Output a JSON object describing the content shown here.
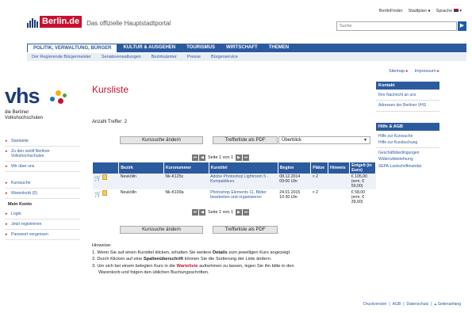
{
  "header": {
    "logo_text": "Berlin.de",
    "subtitle": "Das offizielle Hauptstadtportal",
    "topnav": [
      "BerlinFinder",
      "Stadtplan",
      "Sprache"
    ],
    "search_placeholder": "Suche"
  },
  "mainnav": [
    "POLITIK, VERWALTUNG, BÜRGER",
    "KULTUR & AUSGEHEN",
    "TOURISMUS",
    "WIRTSCHAFT",
    "THEMEN"
  ],
  "subnav": [
    "Der Regierende Bürgermeister",
    "Senatsverwaltungen",
    "Bezirksämter",
    "Presse",
    "Bürgerservice"
  ],
  "vhs": {
    "word": "vhs",
    "sub1": "die Berliner",
    "sub2": "Volkshochschulen"
  },
  "leftnav": {
    "items1": [
      "Startseite",
      "Zu den zwölf Berliner Volkshochschulen",
      "Wir über uns"
    ],
    "items2": [
      "Kurssuche",
      "Warenkorb (0)"
    ],
    "heading": "Mein Konto",
    "items3": [
      "Login",
      "Jetzt registrieren",
      "Passwort vergessen"
    ]
  },
  "main": {
    "title": "Kursliste",
    "treffer": "Anzahl Treffer: 2",
    "btn_change": "Kurssuche ändern",
    "btn_pdf": "Trefferliste als PDF",
    "select_value": "Überblick",
    "pager_text": "Seite 1 von 1"
  },
  "table": {
    "headers": [
      "",
      "Bezirk",
      "Kursnummer",
      "Kurstitel",
      "Beginn",
      "Plätze",
      "Hinweis",
      "Entgelt (in Euro)"
    ],
    "rows": [
      {
        "bezirk": "Neukölln",
        "nr": "Nk-K125c",
        "titel": "Adobe Photoshop Lightroom 5 - Kompaktkurs",
        "beginn": "08.12.2014 09:00 Uhr",
        "plaetze": "> 2",
        "hinweis": "",
        "entgelt1": "€ 105,00",
        "entgelt2": "(erm. € 59,00)"
      },
      {
        "bezirk": "Neukölln",
        "nr": "Nk-K109a",
        "titel": "Photoshop Elements 11, Bilder bearbeiten und organisieren",
        "beginn": "24.01.2015 10:30 Uhr",
        "plaetze": "> 2",
        "hinweis": "",
        "entgelt1": "€ 58,00",
        "entgelt2": "(erm. € 39,60)"
      }
    ]
  },
  "hinweise": {
    "label": "Hinweise:",
    "l1a": "1.  Wenn Sie auf einen Kurstitel klicken, erhalten Sie weitere ",
    "l1b": "Details",
    "l1c": " zum jeweiligen Kurs angezeigt.",
    "l2a": "2.  Durch Klicken auf eine ",
    "l2b": "Spaltenüberschrift",
    "l2c": " können Sie die Sortierung der Liste ändern.",
    "l3a": "3.  Um sich bei einem belegten Kurs in die ",
    "l3b": "Warteliste",
    "l3c": " aufnehmen zu lassen, legen Sie ihn bitte in den",
    "l3d": "Warenkorb und folgen den üblichen Buchungsschritten."
  },
  "right": {
    "sitemap": "Sitemap",
    "impressum": "Impressum",
    "kontakt_head": "Kontakt",
    "kontakt": [
      "Ihre Nachricht an uns",
      "Adressen der Berliner VHS"
    ],
    "agb_head": "Hilfe & AGB",
    "agb1": [
      "Hilfe zur Kurssuche",
      "Hilfe zur Kursbuchung"
    ],
    "agb2": [
      "Geschäftsbedingungen",
      "Widerrufsbelehrung",
      "SEPA-Lastschriftmandat"
    ]
  },
  "footer": [
    "Druckversion",
    "AGB",
    "Datenschutz",
    "Seitenanfang"
  ],
  "colors": {
    "accent": "#2c5a9e",
    "brand_red": "#c8102e"
  }
}
